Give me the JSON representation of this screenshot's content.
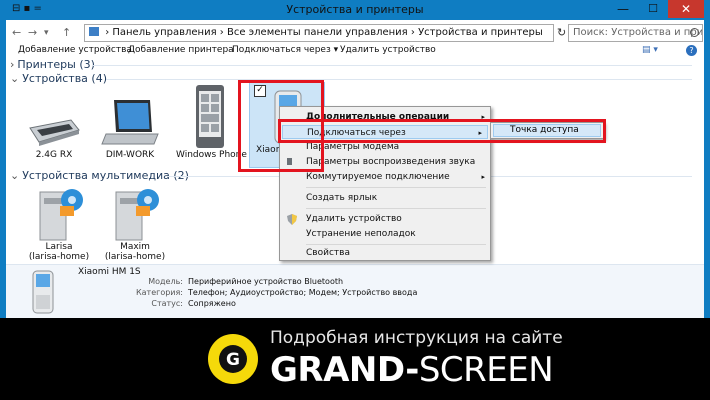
{
  "window": {
    "title": "Устройства и принтеры",
    "quick_access": "⊟ ▪ =",
    "minimize": "—",
    "maximize": "☐",
    "close": "✕"
  },
  "address": {
    "back": "←",
    "forward": "→",
    "dropdown": "▾",
    "up": "↑",
    "path": [
      "Панель управления",
      "Все элементы панели управления",
      "Устройства и принтеры"
    ],
    "sep": "›",
    "refresh": "↻",
    "search_placeholder": "Поиск: Устройства и прин...",
    "search_icon": "search-icon"
  },
  "commandbar": {
    "items": [
      "Добавление устройства",
      "Добавление принтера",
      "Подключаться через",
      "Удалить устройство"
    ],
    "connect_arrow": "▾",
    "view_icon": "▤ ▾",
    "help_icon": "?"
  },
  "groups": {
    "printers": "Принтеры (3)",
    "devices": "Устройства (4)",
    "multimedia": "Устройства мультимедиа (2)",
    "collapsed_marker": "›",
    "expanded_marker": "⌄"
  },
  "devices": [
    {
      "label": "2.4G RX"
    },
    {
      "label": "DIM-WORK"
    },
    {
      "label": "Windows Phone"
    },
    {
      "label": "Xiaomi"
    }
  ],
  "media": [
    {
      "line1": "Larisa",
      "line2": "(larisa-home)"
    },
    {
      "line1": "Maxim",
      "line2": "(larisa-home)"
    }
  ],
  "details": {
    "name": "Xiaomi HM 1S",
    "rows": [
      {
        "key": "Модель:",
        "value": "Периферийное устройство Bluetooth"
      },
      {
        "key": "Категория:",
        "value": "Телефон; Аудиоустройство; Модем; Устройство ввода"
      },
      {
        "key": "Статус:",
        "value": "Сопряжено"
      }
    ]
  },
  "context_menu": {
    "items": [
      {
        "label": "Дополнительные операции",
        "bold": true,
        "arrow": "▸"
      },
      {
        "label": "Подключаться через",
        "arrow": "▸"
      },
      {
        "label": "Параметры модема"
      },
      {
        "label": "Параметры воспроизведения звука"
      },
      {
        "label": "Коммутируемое подключение",
        "arrow": "▸"
      },
      {
        "label": "Создать ярлык"
      },
      {
        "label": "Удалить устройство"
      },
      {
        "label": "Устранение неполадок"
      },
      {
        "label": "Свойства"
      }
    ],
    "submenu_item": "Точка доступа"
  },
  "banner": {
    "tagline": "Подробная инструкция на сайте",
    "brand_bold": "GRAND",
    "brand_dash": "-",
    "brand_light": "SCREEN",
    "logo_letter": "G"
  },
  "colors": {
    "accent": "#0f7dc2",
    "highlight_red": "#e3141f",
    "selection": "#cce4f7",
    "logo_yellow": "#f5d90a"
  }
}
